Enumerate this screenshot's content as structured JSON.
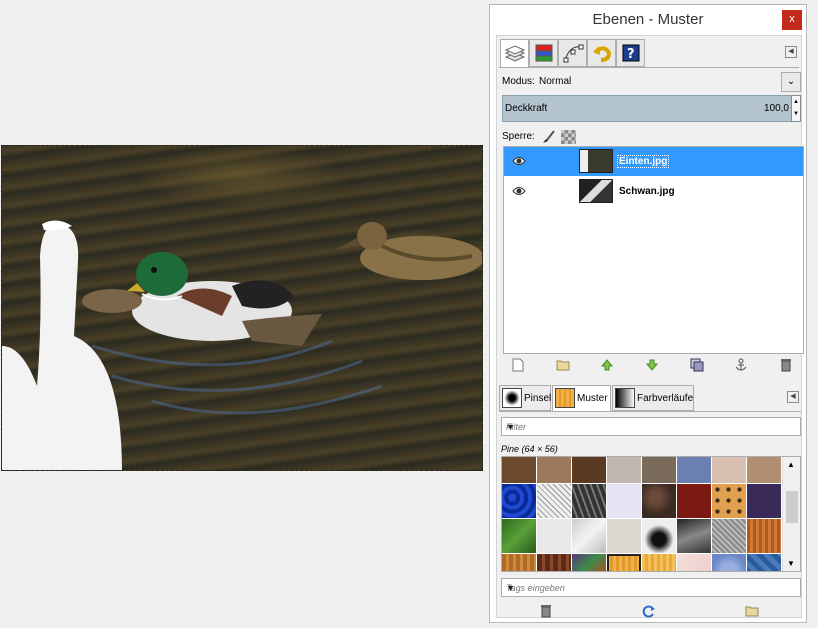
{
  "dock": {
    "title": "Ebenen - Muster",
    "close_label": "x",
    "tabs": [
      "layers-tab",
      "channels-tab",
      "paths-tab",
      "undo-history-tab",
      "help-tab"
    ]
  },
  "layers": {
    "mode_label": "Modus:",
    "mode_value": "Normal",
    "opacity_label": "Deckkraft",
    "opacity_value": "100,0",
    "lock_label": "Sperre:",
    "items": [
      {
        "name": "Einten.jpg",
        "selected": true,
        "visible": true
      },
      {
        "name": "Schwan.jpg",
        "selected": false,
        "visible": true
      }
    ]
  },
  "lower": {
    "tabs": [
      {
        "label": "Pinsel"
      },
      {
        "label": "Muster"
      },
      {
        "label": "Farbverläufe"
      }
    ],
    "filter_placeholder": "Filter",
    "pattern_info": "Pine (64 × 56)",
    "tags_placeholder": "Tags eingeben"
  },
  "colors": {
    "selection": "#3399ff",
    "close": "#c42b1c",
    "opacity_bar": "#b3c4cf"
  }
}
